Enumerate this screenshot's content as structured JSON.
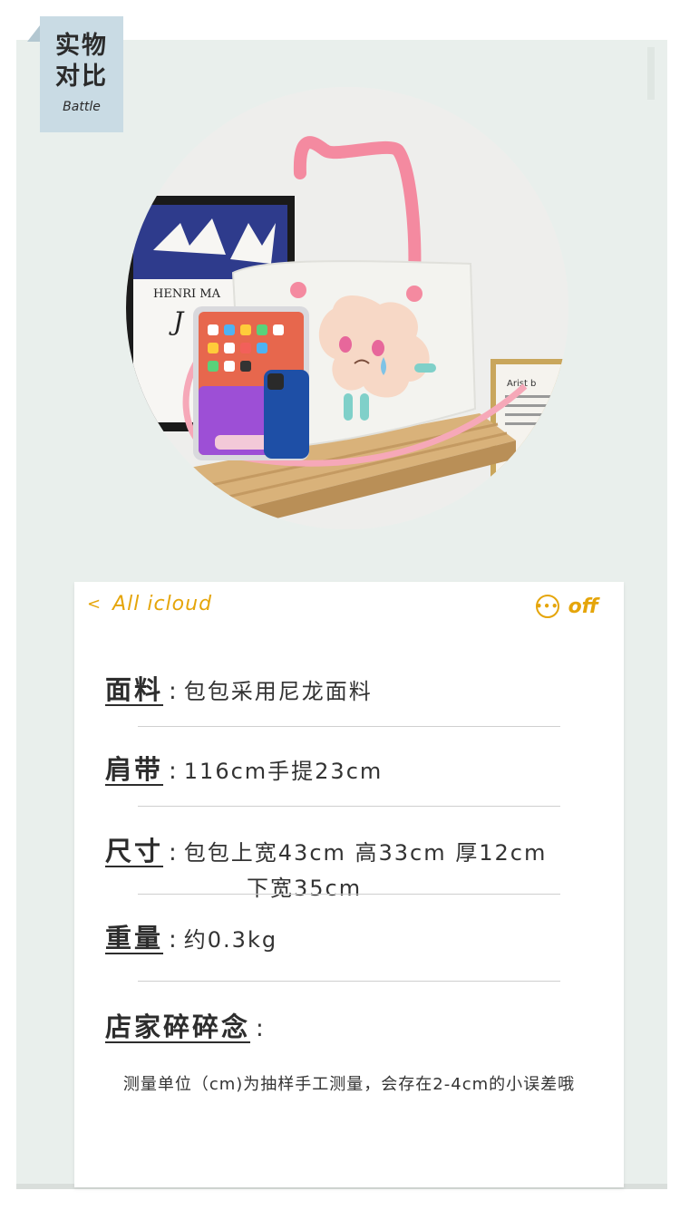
{
  "badge": {
    "line1": "实物",
    "line2": "对比",
    "sub": "Battle"
  },
  "photo": {
    "poster_title": "HENRI MA",
    "poster_mark": "J",
    "card_text": "Arist b"
  },
  "topbar": {
    "back_label": "All icloud",
    "more_label": "off"
  },
  "specs": [
    {
      "label": "面料",
      "value": "包包采用尼龙面料"
    },
    {
      "label": "肩带",
      "value": "116cm手提23cm"
    },
    {
      "label": "尺寸",
      "value": "包包上宽43cm 高33cm 厚12cm",
      "value2": "下宽35cm"
    },
    {
      "label": "重量",
      "value": "约0.3kg"
    },
    {
      "label": "店家碎碎念",
      "value": ""
    }
  ],
  "note": "测量单位（cm)为抽样手工测量，会存在2-4cm的小误差哦",
  "colors": {
    "panel": "#e9efec",
    "accent": "#e5a50a",
    "badge": "#c9dbe4"
  }
}
